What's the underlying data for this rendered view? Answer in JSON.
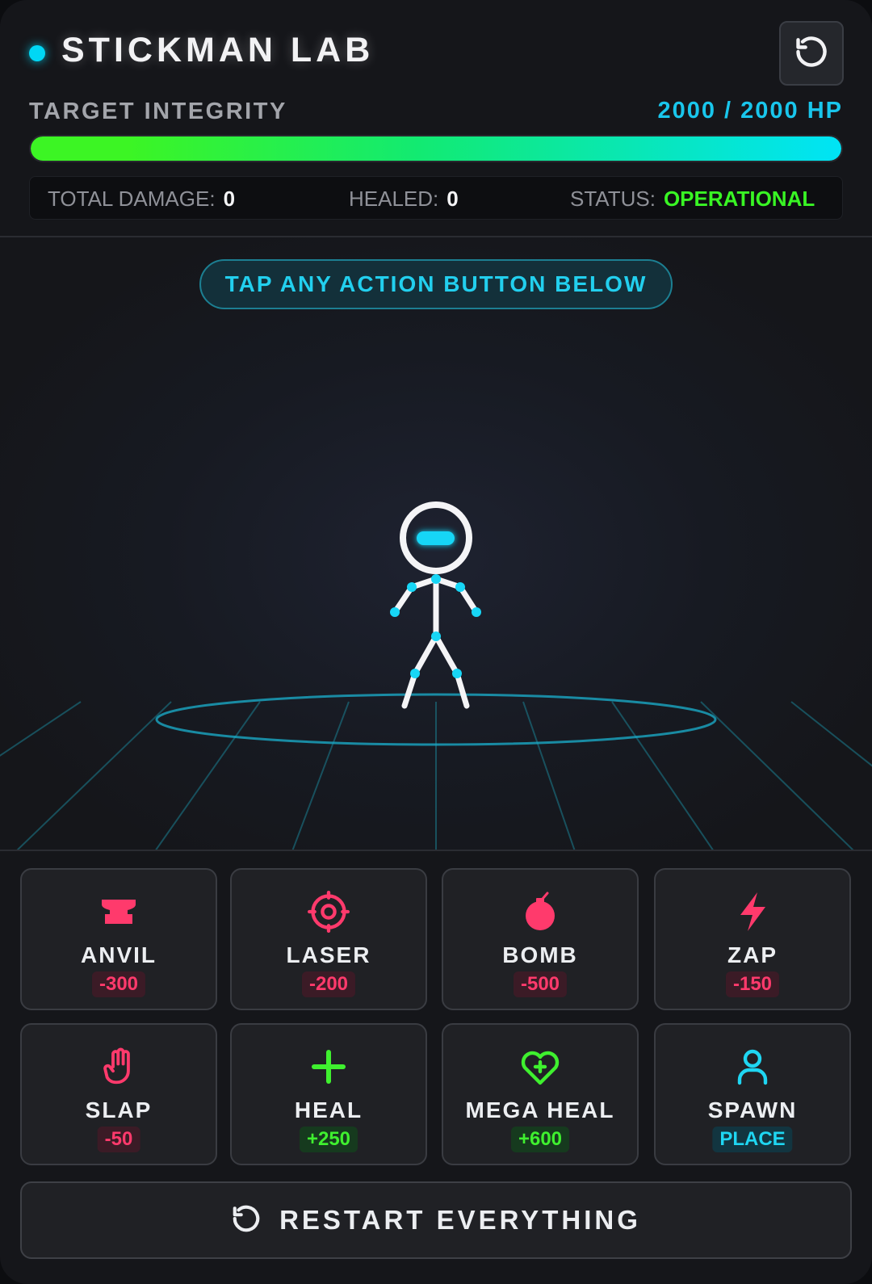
{
  "header": {
    "title": "STICKMAN LAB",
    "reset_icon": "reset-icon"
  },
  "integrity": {
    "label": "TARGET INTEGRITY",
    "readout": "2000 / 2000 HP",
    "current_hp": 2000,
    "max_hp": 2000,
    "fill_fraction": 1.0
  },
  "stats": {
    "damage_label": "TOTAL DAMAGE:",
    "damage_value": "0",
    "healed_label": "HEALED:",
    "healed_value": "0",
    "status_label": "STATUS:",
    "status_value": "OPERATIONAL"
  },
  "arena": {
    "hint": "TAP ANY ACTION BUTTON BELOW"
  },
  "actions": [
    {
      "name": "ANVIL",
      "value": "-300",
      "kind": "damage",
      "icon": "anvil-icon"
    },
    {
      "name": "LASER",
      "value": "-200",
      "kind": "damage",
      "icon": "target-icon"
    },
    {
      "name": "BOMB",
      "value": "-500",
      "kind": "damage",
      "icon": "bomb-icon"
    },
    {
      "name": "ZAP",
      "value": "-150",
      "kind": "damage",
      "icon": "lightning-icon"
    },
    {
      "name": "SLAP",
      "value": "-50",
      "kind": "damage",
      "icon": "hand-icon"
    },
    {
      "name": "HEAL",
      "value": "+250",
      "kind": "heal",
      "icon": "plus-icon"
    },
    {
      "name": "MEGA HEAL",
      "value": "+600",
      "kind": "heal",
      "icon": "heart-plus-icon"
    },
    {
      "name": "SPAWN",
      "value": "PLACE",
      "kind": "place",
      "icon": "person-icon"
    }
  ],
  "restart": {
    "label": "RESTART EVERYTHING",
    "icon": "restart-icon"
  },
  "colors": {
    "accent": "#00d7f5",
    "damage": "#ff3a6c",
    "heal": "#3ff02f",
    "status_ok": "#39f524"
  }
}
